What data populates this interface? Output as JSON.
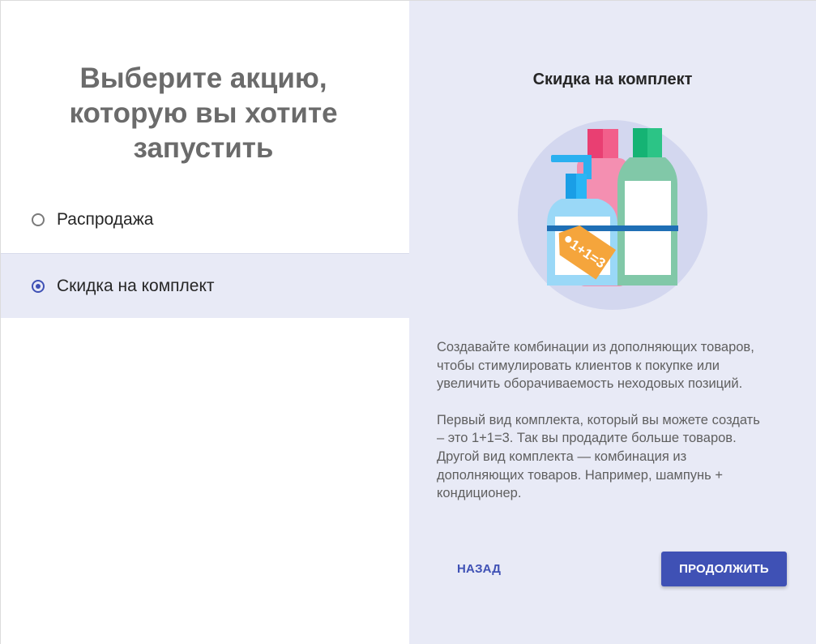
{
  "left": {
    "title": "Выберите акцию,\nкоторую вы хотите\nзапустить",
    "options": [
      {
        "label": "Распродажа",
        "selected": false
      },
      {
        "label": "Скидка на комплект",
        "selected": true
      }
    ]
  },
  "right": {
    "title": "Скидка на комплект",
    "illustration": {
      "icon": "bottles-bundle-icon",
      "tag_text": "1+1=3"
    },
    "paragraphs": [
      "Создавайте комбинации из дополняющих товаров, чтобы стимулировать клиентов к покупке или увеличить оборачиваемость неходовых позиций.",
      "Первый вид комплекта, который вы можете создать – это 1+1=3. Так вы продадите больше товаров. Другой вид комплекта — комбинация из дополняющих товаров. Например, шампунь + кондиционер."
    ],
    "back_label": "НАЗАД",
    "continue_label": "ПРОДОЛЖИТЬ"
  },
  "colors": {
    "accent": "#3f51b5",
    "panel_bg": "#e8eaf6",
    "title_gray": "#6b6b6b"
  }
}
